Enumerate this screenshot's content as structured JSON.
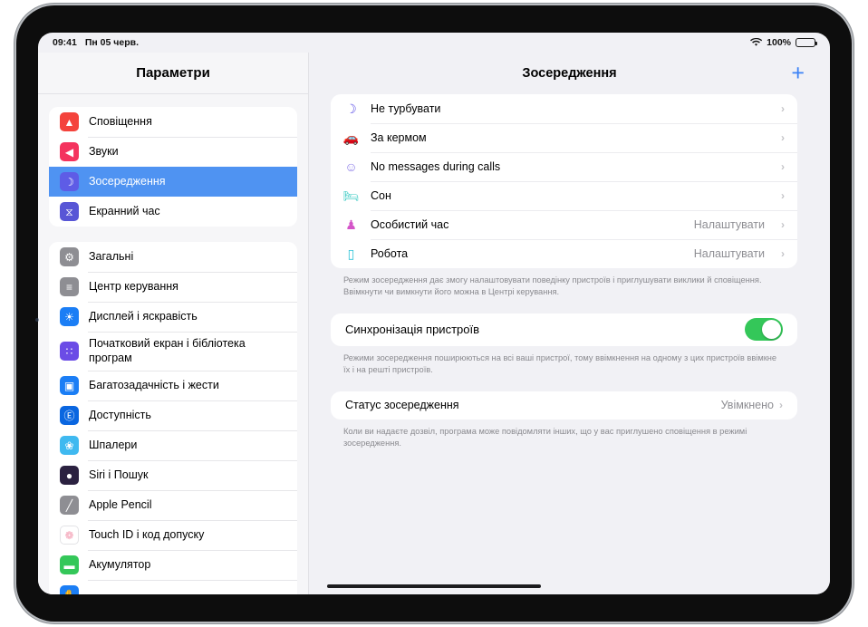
{
  "status_bar": {
    "time": "09:41",
    "date": "Пн 05 черв.",
    "battery_percent": "100%",
    "wifi_icon": "wifi-icon",
    "battery_icon": "battery-full-icon"
  },
  "sidebar": {
    "title": "Параметри",
    "groups": [
      {
        "items": [
          {
            "label": "Сповіщення",
            "icon": "bell-icon",
            "glyph": "▲",
            "color": "#f4433c",
            "selected": false
          },
          {
            "label": "Звуки",
            "icon": "speaker-waves-icon",
            "glyph": "◀",
            "color": "#f4335e",
            "selected": false
          },
          {
            "label": "Зосередження",
            "icon": "moon-icon",
            "glyph": "☽",
            "color": "#5e5ce6",
            "selected": true
          },
          {
            "label": "Екранний час",
            "icon": "hourglass-icon",
            "glyph": "⧖",
            "color": "#5856d6",
            "selected": false
          }
        ]
      },
      {
        "items": [
          {
            "label": "Загальні",
            "icon": "gear-icon",
            "glyph": "⚙",
            "color": "#8e8e93",
            "selected": false
          },
          {
            "label": "Центр керування",
            "icon": "control-center-icon",
            "glyph": "≡",
            "color": "#8e8e93",
            "selected": false
          },
          {
            "label": "Дисплей і яскравість",
            "icon": "brightness-icon",
            "glyph": "☀",
            "color": "#1b7ef5",
            "selected": false
          },
          {
            "label": "Початковий екран і бібліотека програм",
            "icon": "app-grid-icon",
            "glyph": "∷",
            "color": "#6b4ce6",
            "selected": false
          },
          {
            "label": "Багатозадачність і жести",
            "icon": "multitasking-icon",
            "glyph": "▣",
            "color": "#1b7ef5",
            "selected": false
          },
          {
            "label": "Доступність",
            "icon": "accessibility-icon",
            "glyph": "Ⓔ",
            "color": "#0a66e0",
            "selected": false
          },
          {
            "label": "Шпалери",
            "icon": "wallpaper-icon",
            "glyph": "❀",
            "color": "#3fb9f0",
            "selected": false
          },
          {
            "label": "Siri і Пошук",
            "icon": "siri-orb-icon",
            "glyph": "●",
            "color": "#2b2140",
            "selected": false
          },
          {
            "label": "Apple Pencil",
            "icon": "pencil-icon",
            "glyph": "╱",
            "color": "#8e8e93",
            "selected": false
          },
          {
            "label": "Touch ID і код допуску",
            "icon": "fingerprint-icon",
            "glyph": "❁",
            "color": "#ffffff",
            "selected": false
          },
          {
            "label": "Акумулятор",
            "icon": "battery-icon",
            "glyph": "▬",
            "color": "#34c759",
            "selected": false
          },
          {
            "label": "",
            "icon": "privacy-icon",
            "glyph": "✋",
            "color": "#1b7ef5",
            "selected": false
          }
        ]
      }
    ]
  },
  "detail": {
    "title": "Зосередження",
    "add_button": "+",
    "add_button_icon": "plus-icon",
    "focus_modes": [
      {
        "label": "Не турбувати",
        "icon": "moon-icon",
        "glyph": "☽",
        "color": "#6155e8",
        "value": ""
      },
      {
        "label": "За кермом",
        "icon": "car-icon",
        "glyph": "🚗",
        "color": "#5b53e0",
        "value": ""
      },
      {
        "label": "No messages during calls",
        "icon": "smiley-icon",
        "glyph": "☺",
        "color": "#8b7ce8",
        "value": ""
      },
      {
        "label": "Сон",
        "icon": "bed-icon",
        "glyph": "🛏",
        "color": "#30c8c0",
        "value": ""
      },
      {
        "label": "Особистий час",
        "icon": "person-icon",
        "glyph": "♟",
        "color": "#d455c8",
        "value": "Налаштувати"
      },
      {
        "label": "Робота",
        "icon": "id-badge-icon",
        "glyph": "▯",
        "color": "#2ec3d8",
        "value": "Налаштувати"
      }
    ],
    "focus_footnote": "Режим зосередження дає змогу налаштовувати поведінку пристроїв і приглушувати виклики й сповіщення. Ввімкнути чи вимкнути його можна в Центрі керування.",
    "sync_label": "Синхронізація пристроїв",
    "sync_enabled": true,
    "sync_footnote": "Режими зосередження поширюються на всі ваші пристрої, тому ввімкнення на одному з цих пристроїв ввімкне їх і на решті пристроїв.",
    "status_label": "Статус зосередження",
    "status_value": "Увімкнено",
    "status_footnote": "Коли ви надаєте дозвіл, програма може повідомляти інших, що у вас приглушено сповіщення в режимі зосередження."
  },
  "colors": {
    "accent": "#3b82f6",
    "selection": "#4f93f2",
    "toggle_on": "#34c759",
    "screen_bg": "#f1f1f5"
  }
}
